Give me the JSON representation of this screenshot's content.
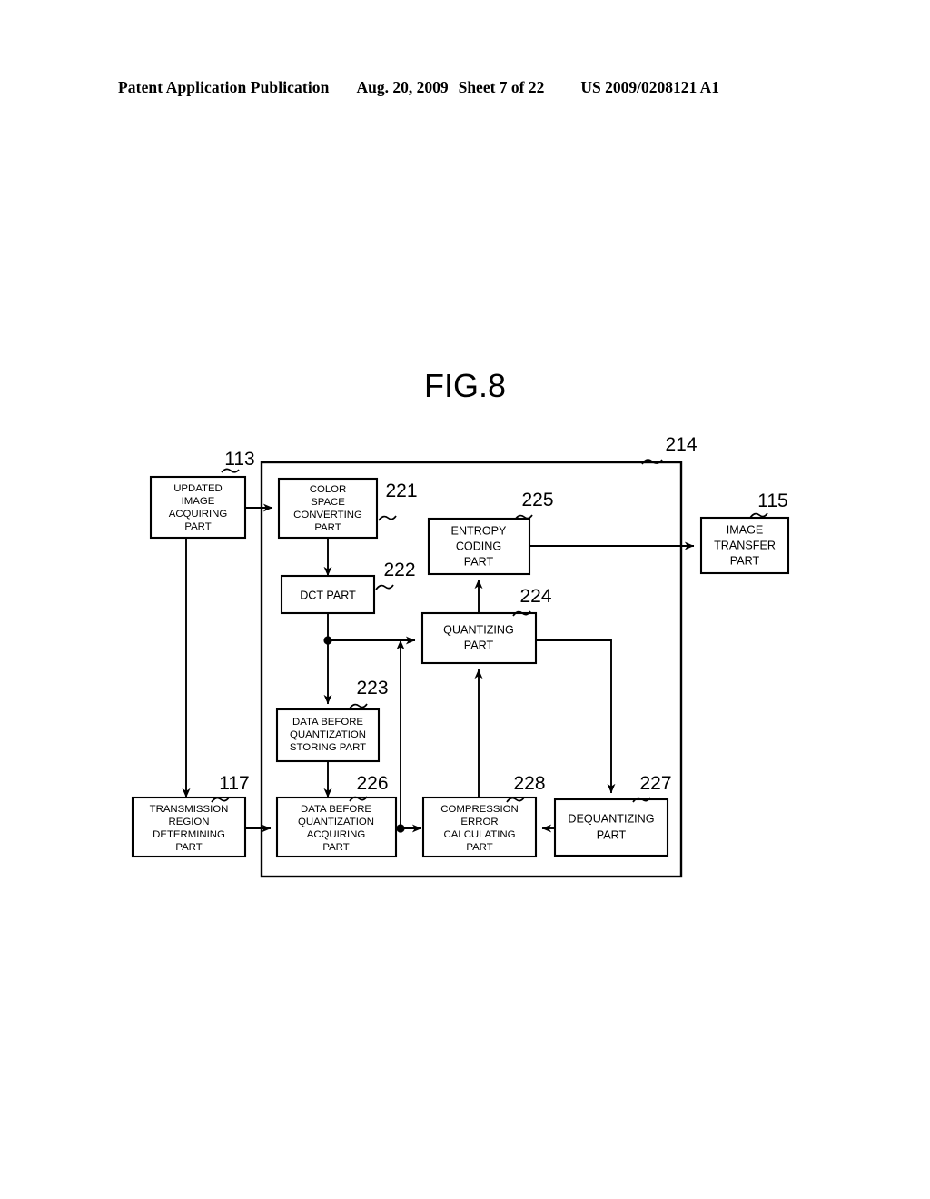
{
  "header": {
    "publication": "Patent Application Publication",
    "date": "Aug. 20, 2009",
    "sheet": "Sheet 7 of 22",
    "patent_number": "US 2009/0208121 A1"
  },
  "figure": {
    "title": "FIG.8"
  },
  "diagram": {
    "container_ref": "214",
    "boxes": [
      {
        "ref": "113",
        "label": "UPDATED\nIMAGE\nACQUIRING\nPART",
        "line1": "UPDATED",
        "line2": "IMAGE",
        "line3": "ACQUIRING",
        "line4": "PART"
      },
      {
        "ref": "221",
        "label": "COLOR\nSPACE\nCONVERTING\nPART",
        "line1": "COLOR",
        "line2": "SPACE",
        "line3": "CONVERTING",
        "line4": "PART"
      },
      {
        "ref": "222",
        "label": "DCT PART",
        "line1": "DCT PART"
      },
      {
        "ref": "223",
        "label": "DATA BEFORE\nQUANTIZATION\nSTORING PART",
        "line1": "DATA BEFORE",
        "line2": "QUANTIZATION",
        "line3": "STORING PART"
      },
      {
        "ref": "224",
        "label": "QUANTIZING\nPART",
        "line1": "QUANTIZING",
        "line2": "PART"
      },
      {
        "ref": "225",
        "label": "ENTROPY\nCODING\nPART",
        "line1": "ENTROPY",
        "line2": "CODING",
        "line3": "PART"
      },
      {
        "ref": "226",
        "label": "DATA BEFORE\nQUANTIZATION\nACQUIRING\nPART",
        "line1": "DATA BEFORE",
        "line2": "QUANTIZATION",
        "line3": "ACQUIRING",
        "line4": "PART"
      },
      {
        "ref": "227",
        "label": "DEQUANTIZING\nPART",
        "line1": "DEQUANTIZING",
        "line2": "PART"
      },
      {
        "ref": "228",
        "label": "COMPRESSION\nERROR\nCALCULATING\nPART",
        "line1": "COMPRESSION",
        "line2": "ERROR",
        "line3": "CALCULATING",
        "line4": "PART"
      },
      {
        "ref": "117",
        "label": "TRANSMISSION\nREGION\nDETERMINING\nPART",
        "line1": "TRANSMISSION",
        "line2": "REGION",
        "line3": "DETERMINING",
        "line4": "PART"
      },
      {
        "ref": "115",
        "label": "IMAGE\nTRANSFER\nPART",
        "line1": "IMAGE",
        "line2": "TRANSFER",
        "line3": "PART"
      }
    ],
    "box_text": {
      "b113": {
        "l1": "UPDATED",
        "l2": "IMAGE",
        "l3": "ACQUIRING",
        "l4": "PART"
      },
      "b221": {
        "l1": "COLOR",
        "l2": "SPACE",
        "l3": "CONVERTING",
        "l4": "PART"
      },
      "b222": {
        "l1": "DCT PART"
      },
      "b223": {
        "l1": "DATA BEFORE",
        "l2": "QUANTIZATION",
        "l3": "STORING PART"
      },
      "b224": {
        "l1": "QUANTIZING",
        "l2": "PART"
      },
      "b225": {
        "l1": "ENTROPY",
        "l2": "CODING",
        "l3": "PART"
      },
      "b226": {
        "l1": "DATA BEFORE",
        "l2": "QUANTIZATION",
        "l3": "ACQUIRING",
        "l4": "PART"
      },
      "b227": {
        "l1": "DEQUANTIZING",
        "l2": "PART"
      },
      "b228": {
        "l1": "COMPRESSION",
        "l2": "ERROR",
        "l3": "CALCULATING",
        "l4": "PART"
      },
      "b117": {
        "l1": "TRANSMISSION",
        "l2": "REGION",
        "l3": "DETERMINING",
        "l4": "PART"
      },
      "b115": {
        "l1": "IMAGE",
        "l2": "TRANSFER",
        "l3": "PART"
      }
    },
    "refs": {
      "r113": "113",
      "r221": "221",
      "r222": "222",
      "r223": "223",
      "r224": "224",
      "r225": "225",
      "r226": "226",
      "r227": "227",
      "r228": "228",
      "r117": "117",
      "r115": "115",
      "r214": "214"
    }
  },
  "colors": {
    "ink": "#000000",
    "paper": "#ffffff"
  }
}
